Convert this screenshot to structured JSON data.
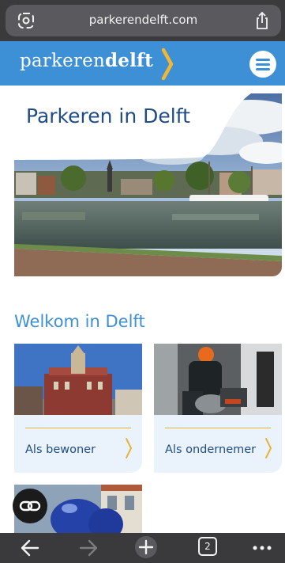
{
  "browser": {
    "url": "parkerendelft.com",
    "tab_count": "2"
  },
  "site": {
    "logo_regular": "parkeren",
    "logo_bold": "delft",
    "brand_color": "#3d8fd6",
    "accent_color": "#e6b43a",
    "title_color": "#1f4c86"
  },
  "hero": {
    "title": "Parkeren in Delft"
  },
  "welcome": {
    "heading": "Welkom in Delft",
    "cards": [
      {
        "label": "Als bewoner"
      },
      {
        "label": "Als ondernemer"
      }
    ]
  },
  "icons": {
    "address_left": "reader-icon",
    "share": "share-icon",
    "menu": "hamburger-icon",
    "fab": "link-icon",
    "back": "back-arrow-icon",
    "forward": "forward-arrow-icon",
    "new_tab": "plus-icon",
    "tabs": "tabs-icon",
    "more": "more-icon"
  }
}
